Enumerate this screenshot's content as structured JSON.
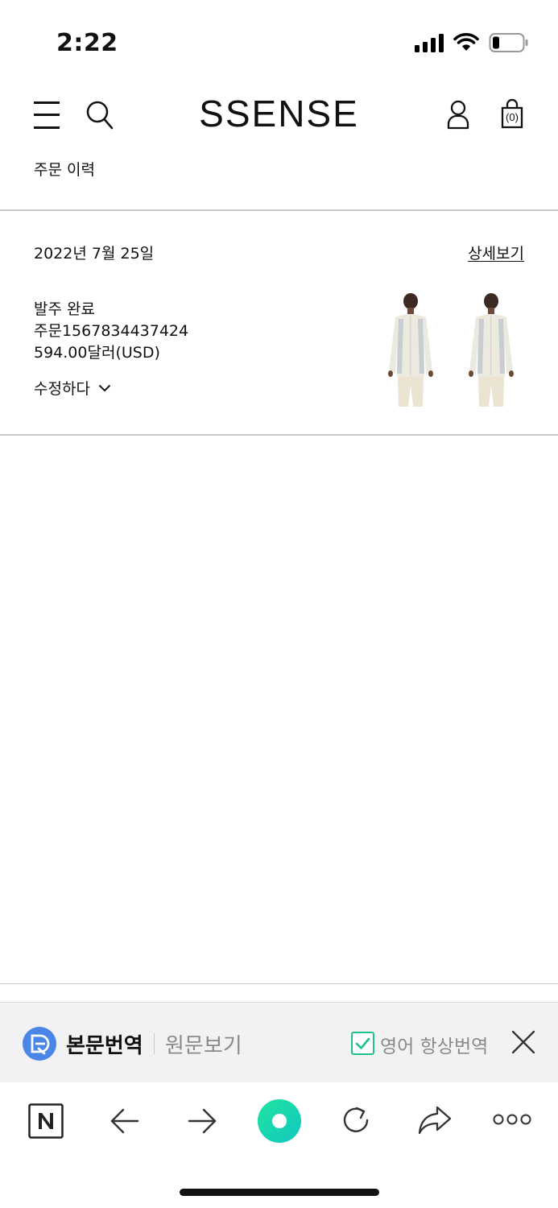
{
  "status_bar": {
    "time": "2:22"
  },
  "header": {
    "logo": "SSENSE",
    "bag_count": "(0)"
  },
  "page": {
    "title": "주문 이력"
  },
  "order": {
    "date": "2022년 7월 25일",
    "details_link": "상세보기",
    "status": "발주 완료",
    "number": "주문1567834437424",
    "total": "594.00달러(USD)",
    "modify_label": "수정하다"
  },
  "translate_bar": {
    "translate_label": "본문번역",
    "original_label": "원문보기",
    "always_label": "영어 항상번역",
    "always_checked": true
  },
  "colors": {
    "accent_green": "#1ec28b",
    "translate_blue": "#4a86e8",
    "divider": "#c8c8c8",
    "bar_bg": "#f2f2f4"
  },
  "icons": [
    "menu-icon",
    "search-icon",
    "account-icon",
    "bag-icon",
    "chevron-down-icon",
    "translate-logo-icon",
    "checkbox-icon",
    "close-icon",
    "naver-icon",
    "back-arrow-icon",
    "forward-arrow-icon",
    "green-dot-icon",
    "refresh-icon",
    "share-icon",
    "more-icon"
  ]
}
